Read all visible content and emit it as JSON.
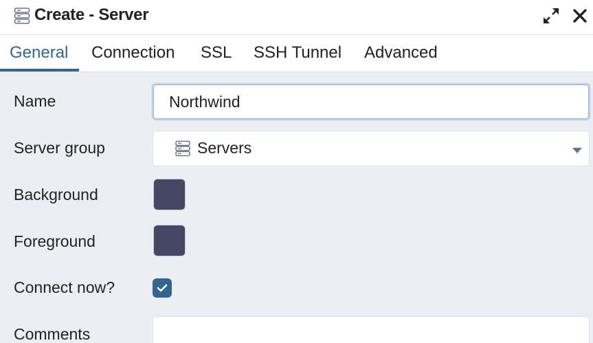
{
  "dialog": {
    "title": "Create - Server",
    "icon": "server-icon",
    "controls": {
      "maximize_icon": "maximize-arrows-icon",
      "close_icon": "close-icon"
    }
  },
  "tabs": [
    {
      "label": "General",
      "active": true
    },
    {
      "label": "Connection",
      "active": false
    },
    {
      "label": "SSL",
      "active": false
    },
    {
      "label": "SSH Tunnel",
      "active": false
    },
    {
      "label": "Advanced",
      "active": false
    }
  ],
  "form": {
    "name": {
      "label": "Name",
      "value": "Northwind"
    },
    "server_group": {
      "label": "Server group",
      "value": "Servers",
      "icon": "server-group-icon"
    },
    "background": {
      "label": "Background",
      "color": "#454862"
    },
    "foreground": {
      "label": "Foreground",
      "color": "#454862"
    },
    "connect_now": {
      "label": "Connect now?",
      "checked": true
    },
    "comments": {
      "label": "Comments",
      "value": ""
    }
  },
  "colors": {
    "accent": "#326690",
    "panel_background": "#ebeef3"
  }
}
